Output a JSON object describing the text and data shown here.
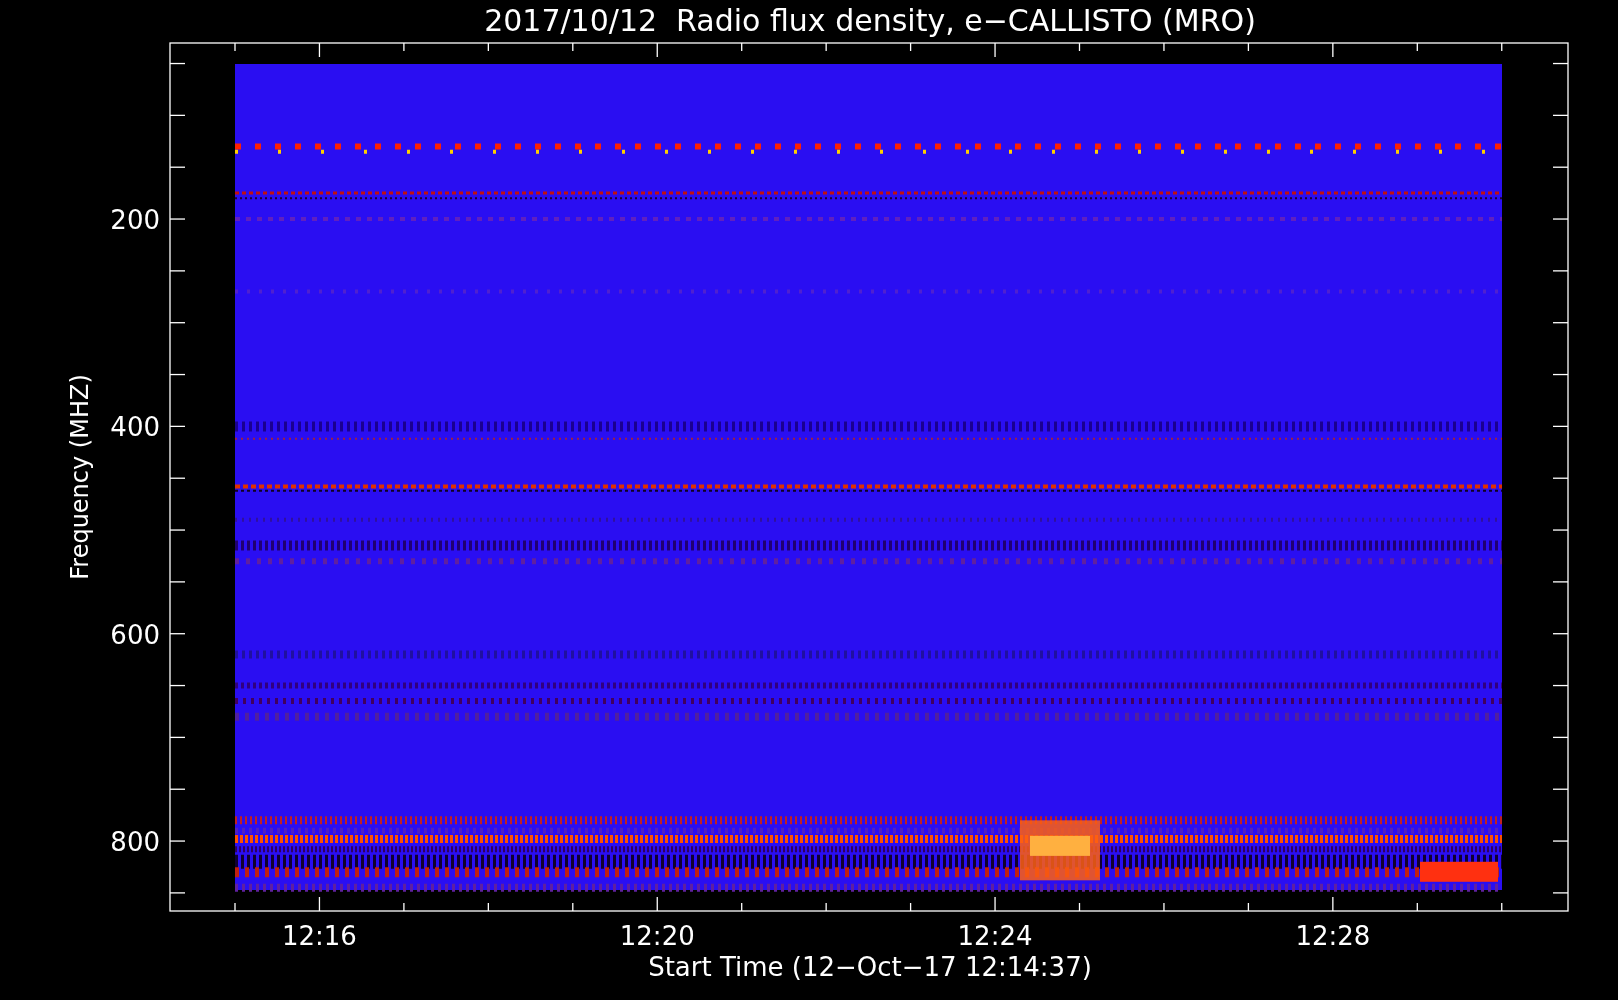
{
  "title": "2017/10/12  Radio flux density, e−CALLISTO (MRO)",
  "y_axis": {
    "label": "Frequency (MHZ)",
    "ticks": [
      "200",
      "400",
      "600",
      "800"
    ]
  },
  "x_axis": {
    "label": "Start Time (12−Oct−17 12:14:37)",
    "ticks": [
      "12:16",
      "12:20",
      "12:24",
      "12:28"
    ]
  }
}
